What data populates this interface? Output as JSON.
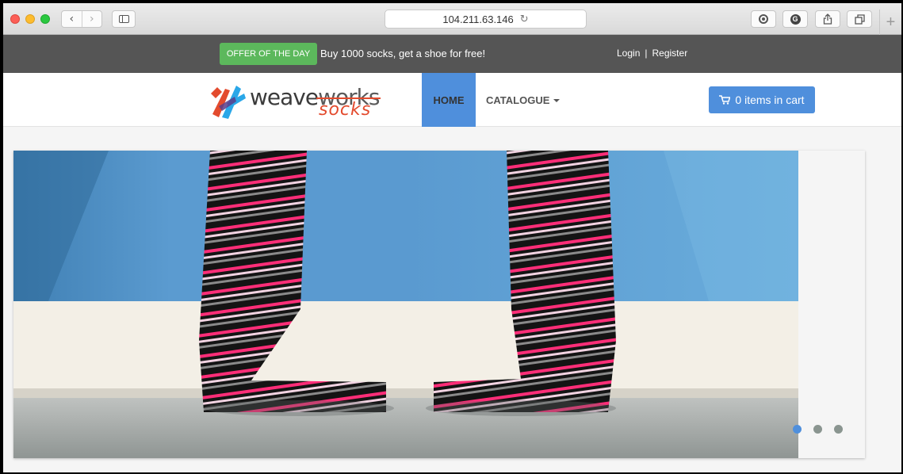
{
  "browser": {
    "address": "104.211.63.146",
    "back_icon": "chevron-left-icon",
    "forward_icon": "chevron-right-icon",
    "reload_icon": "reload-icon"
  },
  "topbar": {
    "offer_label": "OFFER OF THE DAY",
    "offer_text": "Buy 1000 socks, get a shoe for free!",
    "login": "Login",
    "separator": "|",
    "register": "Register"
  },
  "logo": {
    "brand_prefix": "weave",
    "brand_works": "works",
    "brand_sub": "socks"
  },
  "nav": {
    "home": "HOME",
    "catalogue": "CATALOGUE"
  },
  "cart": {
    "label": "0 items in cart"
  },
  "carousel": {
    "slide_count": 3,
    "active_index": 0
  },
  "colors": {
    "topbar": "#555555",
    "offer_green": "#5cb85c",
    "accent_blue": "#4f8fdc",
    "logo_orange": "#e34b2e",
    "logo_blue": "#2aa7e8"
  }
}
